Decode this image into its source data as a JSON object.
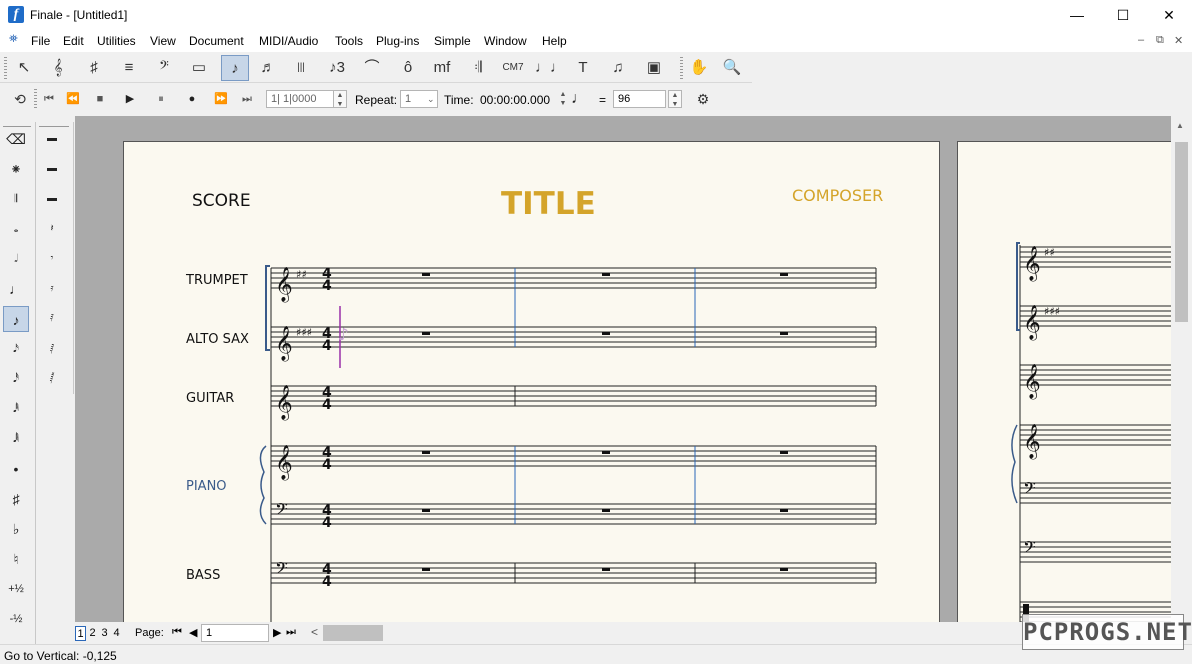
{
  "window": {
    "title": "Finale - [Untitled1]",
    "minimize": "—",
    "maximize": "☐",
    "close": "✕"
  },
  "menu": [
    "File",
    "Edit",
    "Utilities",
    "View",
    "Document",
    "MIDI/Audio",
    "Tools",
    "Plug-ins",
    "Simple",
    "Window",
    "Help"
  ],
  "mdi": [
    "–",
    "⧉",
    "✕"
  ],
  "toolbar1": {
    "tools": [
      {
        "name": "selection-tool",
        "glyph": "↖"
      },
      {
        "name": "staff-tool",
        "glyph": "𝄞"
      },
      {
        "name": "key-signature-tool",
        "glyph": "♯"
      },
      {
        "name": "time-signature-tool",
        "glyph": "≡"
      },
      {
        "name": "clef-tool",
        "glyph": "𝄢"
      },
      {
        "name": "measure-tool",
        "glyph": "▭"
      },
      {
        "name": "simple-entry-tool",
        "glyph": "♪"
      },
      {
        "name": "speedy-entry-tool",
        "glyph": "♬"
      },
      {
        "name": "articulation-tool",
        "glyph": "|||"
      },
      {
        "name": "tuplet-tool",
        "glyph": "♪3"
      },
      {
        "name": "smart-shape-tool",
        "glyph": "⌒"
      },
      {
        "name": "ornament-tool",
        "glyph": "ô"
      },
      {
        "name": "expression-tool",
        "glyph": "mf"
      },
      {
        "name": "repeat-tool",
        "glyph": "𝄇"
      },
      {
        "name": "chord-tool",
        "glyph": "CM7"
      },
      {
        "name": "lyrics-tool",
        "glyph": "♩♩"
      },
      {
        "name": "text-tool",
        "glyph": "T"
      },
      {
        "name": "mirror-tool",
        "glyph": "♫"
      },
      {
        "name": "page-layout-tool",
        "glyph": "▣"
      }
    ],
    "hand_glyph": "✋",
    "zoom_glyph": "🔍"
  },
  "playback": {
    "loop_glyph": "⟲",
    "rewind": "⏮",
    "back": "⏪",
    "stop": "■",
    "play": "▶",
    "pause": "⏸",
    "record": "●",
    "forward": "⏩",
    "end": "⏭",
    "measure_value": "1| 1|0000",
    "repeat_label": "Repeat:",
    "repeat_value": "1",
    "time_label": "Time:",
    "time_value": "00:00:00.000",
    "tempo_note_glyph": "♩",
    "equals": "=",
    "tempo_value": "96",
    "settings_glyph": "⚙"
  },
  "palette1": [
    {
      "name": "eraser-tool",
      "glyph": "⌫"
    },
    {
      "name": "tie-tool",
      "glyph": "⁕"
    },
    {
      "name": "rest-tool",
      "glyph": "𝄂"
    },
    {
      "name": "whole-note",
      "glyph": "𝅝"
    },
    {
      "name": "half-note",
      "glyph": "𝅗𝅥"
    },
    {
      "name": "quarter-note",
      "glyph": "♩"
    },
    {
      "name": "eighth-note",
      "glyph": "♪"
    },
    {
      "name": "sixteenth-note",
      "glyph": "𝅘𝅥𝅯"
    },
    {
      "name": "thirty-second-note",
      "glyph": "𝅘𝅥𝅰"
    },
    {
      "name": "sixty-fourth-note",
      "glyph": "𝅘𝅥𝅱"
    },
    {
      "name": "one-twenty-eighth-note",
      "glyph": "𝅘𝅥𝅲"
    },
    {
      "name": "dot-tool",
      "glyph": "•"
    },
    {
      "name": "sharp-tool",
      "glyph": "♯"
    },
    {
      "name": "flat-tool",
      "glyph": "♭"
    },
    {
      "name": "natural-tool",
      "glyph": "♮"
    },
    {
      "name": "half-step-up",
      "glyph": "+½"
    },
    {
      "name": "half-step-down",
      "glyph": "-½"
    }
  ],
  "palette2": [
    {
      "name": "whole-rest",
      "glyph": "▬"
    },
    {
      "name": "half-rest",
      "glyph": "▬"
    },
    {
      "name": "quarter-rest-alt",
      "glyph": "▬"
    },
    {
      "name": "quarter-rest",
      "glyph": "𝄽"
    },
    {
      "name": "eighth-rest",
      "glyph": "𝄾"
    },
    {
      "name": "sixteenth-rest",
      "glyph": "𝄿"
    },
    {
      "name": "thirty-second-rest",
      "glyph": "𝅀"
    },
    {
      "name": "sixty-fourth-rest",
      "glyph": "𝅁"
    },
    {
      "name": "one-twenty-eighth-rest",
      "glyph": "𝅂"
    }
  ],
  "score": {
    "score_label": "SCORE",
    "title": "TITLE",
    "composer": "COMPOSER",
    "title_color": "#d4a42a",
    "piano_color": "#3a5b8a",
    "staves": [
      "TRUMPET",
      "ALTO SAX",
      "GUITAR",
      "PIANO",
      "BASS"
    ]
  },
  "navigation": {
    "page_tabs": [
      "1",
      "2",
      "3",
      "4"
    ],
    "page_label": "Page:",
    "page_value": "1",
    "first": "⏮",
    "prev": "◀",
    "next": "▶",
    "last": "⏭",
    "left_arrow": "<"
  },
  "status": {
    "text": "Go to Vertical: -0,125"
  },
  "watermark": "PCPROGS.NET"
}
